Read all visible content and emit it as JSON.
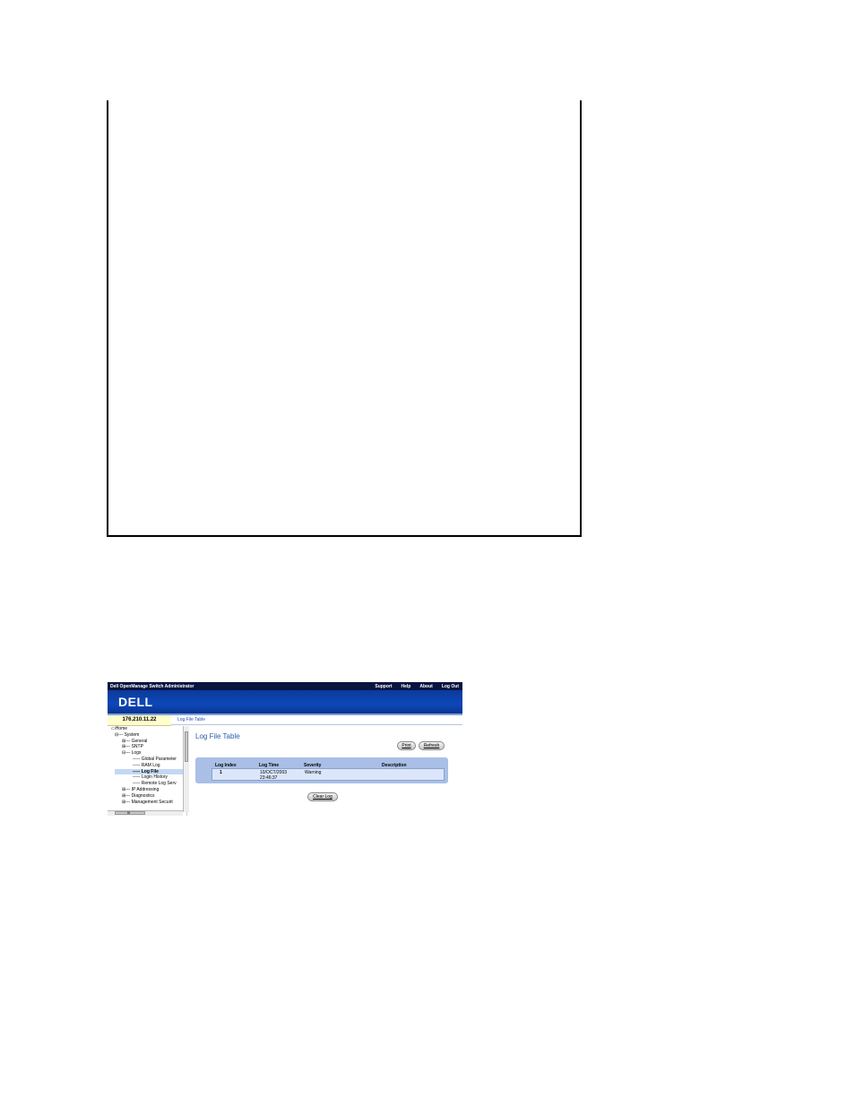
{
  "app": {
    "title": "Dell OpenManage Switch Administrator",
    "top_links": [
      "Support",
      "Help",
      "About",
      "Log Out"
    ],
    "logo": "DELL",
    "ip_address": "176.210.11.22",
    "breadcrumb": "Log File Table"
  },
  "tree": {
    "items": [
      {
        "label": "Home",
        "prefix": "▭"
      },
      {
        "label": "System",
        "prefix": "⊟"
      },
      {
        "label": "General",
        "prefix": "⊞"
      },
      {
        "label": "SNTP",
        "prefix": "⊞"
      },
      {
        "label": "Logs",
        "prefix": "⊟"
      },
      {
        "label": "Global Parameter",
        "prefix": ""
      },
      {
        "label": "RAM Log",
        "prefix": ""
      },
      {
        "label": "Log File",
        "prefix": "",
        "selected": true
      },
      {
        "label": "Login History",
        "prefix": ""
      },
      {
        "label": "Remote Log Serv",
        "prefix": ""
      },
      {
        "label": "IP Addressing",
        "prefix": "⊞"
      },
      {
        "label": "Diagnostics",
        "prefix": "⊞"
      },
      {
        "label": "Management Securit",
        "prefix": "⊞"
      }
    ],
    "hscroll_mark": "III"
  },
  "main": {
    "page_title": "Log File Table",
    "print_label": "Print",
    "refresh_label": "Refresh",
    "clear_log_label": "Clear Log",
    "table": {
      "columns": [
        "Log Index",
        "Log Time",
        "Severity",
        "Description"
      ],
      "rows": [
        {
          "index": "1",
          "time_date": "10/OCT/2003",
          "time_clock": "23:46:37",
          "severity": "Warning",
          "description": ""
        }
      ]
    }
  },
  "colors": {
    "topbar": "#0a1440",
    "brand": "#0d47b8",
    "ip_bg": "#ffffcc",
    "title": "#2a5cad",
    "table": "#a9bfe6"
  }
}
